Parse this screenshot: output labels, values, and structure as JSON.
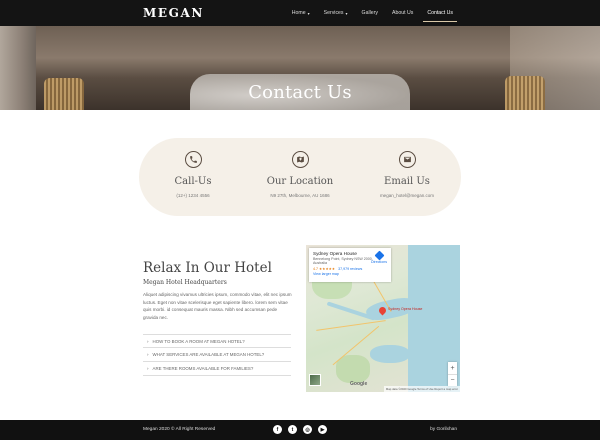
{
  "site": {
    "logo": "MEGAN"
  },
  "nav": {
    "items": [
      {
        "label": "Home",
        "caret": "▾"
      },
      {
        "label": "Services",
        "caret": "▾"
      },
      {
        "label": "Gallery",
        "caret": ""
      },
      {
        "label": "About Us",
        "caret": ""
      },
      {
        "label": "Contact Us",
        "caret": ""
      }
    ],
    "active": "Contact Us"
  },
  "hero": {
    "title": "Contact Us"
  },
  "contact": {
    "items": [
      {
        "icon": "phone-icon",
        "title": "Call-Us",
        "value": "(12+) 1234 4556"
      },
      {
        "icon": "location-icon",
        "title": "Our Location",
        "value": "N9 27th, Melbourne, AU 1686"
      },
      {
        "icon": "email-icon",
        "title": "Email Us",
        "value": "megan_hotel@megan.com"
      }
    ]
  },
  "relax": {
    "title": "Relax In Our Hotel",
    "subtitle": "Megan Hotel Headquarters",
    "text": "Aliquet adipiscing vivamus ultricies ipsum, commodo vitae, elit nec ipsum luctus. Eget non vitae scelerisque eget sapiente libero. lorem sem vitae quis morbi. id consequat mauris massa. Nibh sed accumsan pede gravida nec."
  },
  "faq": [
    {
      "label": "HOW TO BOOK A ROOM AT MEGAN HOTEL?"
    },
    {
      "label": "WHAT SERVICES ARE AVAILABLE AT MEGAN HOTEL?"
    },
    {
      "label": "ARE THERE ROOMS AVAILABLE FOR FAMILIES?"
    }
  ],
  "map": {
    "place_name": "Sydney Opera House",
    "address": "Bennelong Point, Sydney NSW 2000, Australia",
    "rating": "4.7 ★★★★★",
    "reviews": "37,979 reviews",
    "larger_link": "View larger map",
    "directions": "Directions",
    "pin_label": "Sydney Opera House",
    "zoom_in": "+",
    "zoom_out": "−",
    "google": "Google",
    "attribution": "Map data ©2020 Google   Terms of Use   Report a map error"
  },
  "footer": {
    "copyright": "Megan 2020 © All Right Reserved",
    "social": [
      {
        "icon": "facebook-icon",
        "glyph": "f"
      },
      {
        "icon": "twitter-icon",
        "glyph": "t"
      },
      {
        "icon": "instagram-icon",
        "glyph": "◎"
      },
      {
        "icon": "youtube-icon",
        "glyph": "▶"
      }
    ],
    "by": "by Gorilxhan"
  }
}
